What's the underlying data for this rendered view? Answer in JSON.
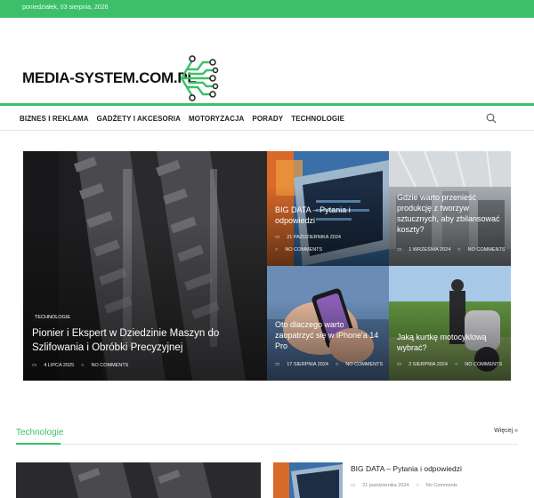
{
  "topbar": {
    "date": "poniedziałek, 03 sierpnia, 2026"
  },
  "header": {
    "logo_text": "MEDIA-SYSTEM.COM.PL"
  },
  "nav": {
    "items": [
      "BIZNES I REKLAMA",
      "GADŻETY I AKCESORIA",
      "MOTORYZACJA",
      "PORADY",
      "TECHNOLOGIE"
    ]
  },
  "featured": {
    "main": {
      "category": "TECHNOLOGIE",
      "title": "Pionier i Ekspert w Dziedzinie Maszyn do Szlifowania i Obróbki Precyzyjnej",
      "date": "4 LIPCA 2025",
      "comments": "NO COMMENTS"
    },
    "tiles": [
      {
        "title": "BIG DATA – Pytania i odpowiedzi",
        "date": "21 PAŹDZIERNIKA 2024",
        "comments": "NO COMMENTS"
      },
      {
        "title": "Gdzie warto przenieść produkcję z tworzyw sztucznych, aby zbilansować koszty?",
        "date": "1 WRZEŚNIA 2024",
        "comments": "NO COMMENTS"
      },
      {
        "title": "Oto dlaczego warto zaopatrzyć się w iPhone'a 14 Pro",
        "date": "17 SIERPNIA 2024",
        "comments": "NO COMMENTS"
      },
      {
        "title": "Jaką kurtkę motocyklową wybrać?",
        "date": "2 SIERPNIA 2024",
        "comments": "NO COMMENTS"
      }
    ]
  },
  "section": {
    "title": "Technologie",
    "more": "Więcej »"
  },
  "list": {
    "item_title": "BIG DATA – Pytania i odpowiedzi",
    "item_date": "21 października 2024",
    "item_comments": "No Comments"
  },
  "colors": {
    "accent": "#3dbf69"
  }
}
